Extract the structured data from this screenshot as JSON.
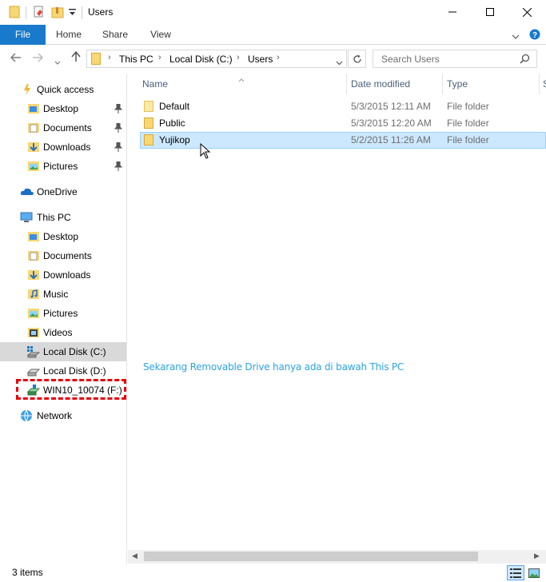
{
  "window": {
    "title": "Users",
    "minimize": "—",
    "maximize": "☐",
    "close": "✕"
  },
  "ribbon": {
    "tabs": [
      "File",
      "Home",
      "Share",
      "View"
    ],
    "expand": "⌄",
    "help": "?"
  },
  "nav": {
    "back": "←",
    "forward": "→",
    "recent": "⌄",
    "up": "↑",
    "address": [
      "This PC",
      "Local Disk (C:)",
      "Users"
    ],
    "search_placeholder": "Search Users"
  },
  "navpane": {
    "quick_access": "Quick access",
    "quick_items": [
      "Desktop",
      "Documents",
      "Downloads",
      "Pictures"
    ],
    "onedrive": "OneDrive",
    "this_pc": "This PC",
    "pc_items": [
      "Desktop",
      "Documents",
      "Downloads",
      "Music",
      "Pictures",
      "Videos",
      "Local Disk (C:)",
      "Local Disk (D:)",
      "WIN10_10074 (F:)"
    ],
    "network": "Network"
  },
  "columns": {
    "name": "Name",
    "date": "Date modified",
    "type": "Type",
    "size": "S"
  },
  "files": [
    {
      "name": "Default",
      "date": "5/3/2015 12:11 AM",
      "type": "File folder"
    },
    {
      "name": "Public",
      "date": "5/3/2015 12:20 AM",
      "type": "File folder"
    },
    {
      "name": "Yujikop",
      "date": "5/2/2015 11:26 AM",
      "type": "File folder"
    }
  ],
  "annotation": "Sekarang Removable Drive hanya ada di bawah This PC",
  "status": {
    "count": "3 items"
  },
  "colors": {
    "accent": "#1979ca",
    "selection": "#cce8ff",
    "highlight_box": "#e8000b",
    "annotation": "#2ca3e3"
  }
}
